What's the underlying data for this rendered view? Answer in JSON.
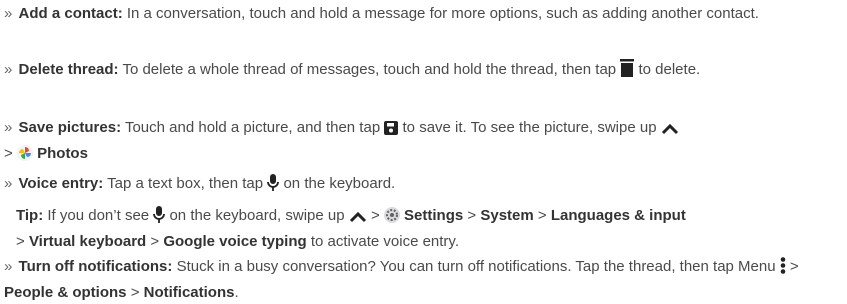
{
  "bullet": "»",
  "gt": ">",
  "add_contact": {
    "title": "Add a contact:",
    "text": "In a conversation, touch and hold a message for more options, such as adding another contact."
  },
  "delete_thread": {
    "title": "Delete thread:",
    "text_a": "To delete a whole thread of messages, touch and hold the thread, then tap",
    "text_b": "to delete.",
    "icon": "trash-icon"
  },
  "save_pictures": {
    "title": "Save pictures:",
    "text_a": "Touch and hold a picture, and then tap",
    "text_b": "to save it. To see the picture, swipe up",
    "photos_label": "Photos",
    "icons": [
      "save-icon",
      "chevron-up-icon",
      "photos-app-icon"
    ]
  },
  "voice_entry": {
    "title": "Voice entry:",
    "text_a": "Tap a text box, then tap",
    "text_b": "on the keyboard.",
    "icon": "microphone-icon"
  },
  "tip": {
    "label": "Tip:",
    "text_a": "If you don’t see",
    "text_b": "on the keyboard, swipe up",
    "settings": "Settings",
    "system": "System",
    "languages": "Languages & input",
    "virtual_keyboard": "Virtual keyboard",
    "google_voice": "Google voice typing",
    "text_c": "to activate voice entry.",
    "icons": [
      "microphone-icon",
      "chevron-up-icon",
      "settings-gear-icon"
    ]
  },
  "notifications": {
    "title": "Turn off notifications:",
    "text_a": "Stuck in a busy conversation? You can turn off notifications. Tap the thread, then tap Menu",
    "people_options": "People & options",
    "notifications_label": "Notifications",
    "end": ".",
    "icon": "menu-dots-icon"
  }
}
